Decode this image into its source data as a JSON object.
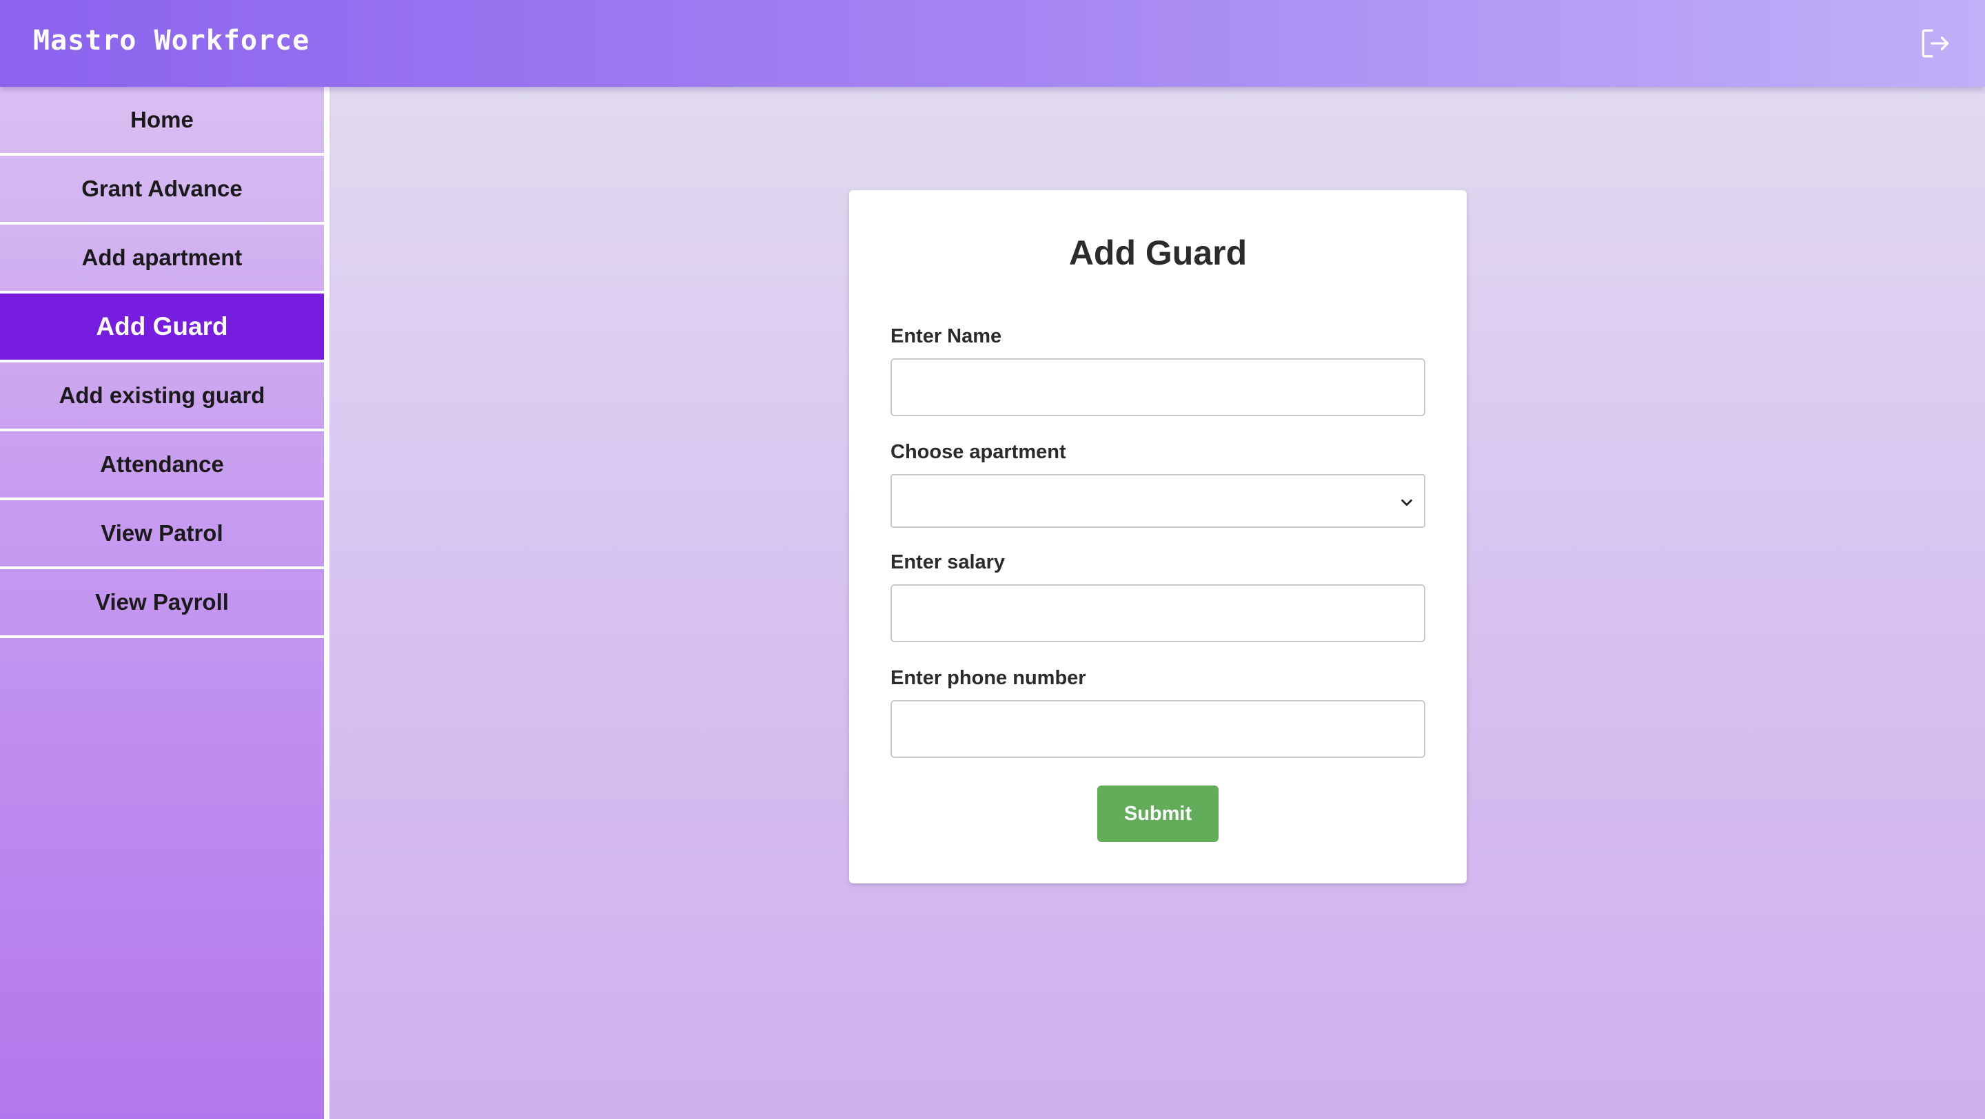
{
  "header": {
    "app_title": "Mastro Workforce",
    "logout_icon": "logout-icon"
  },
  "sidebar": {
    "items": [
      {
        "label": "Home",
        "active": false
      },
      {
        "label": "Grant Advance",
        "active": false
      },
      {
        "label": "Add apartment",
        "active": false
      },
      {
        "label": "Add Guard",
        "active": true
      },
      {
        "label": "Add existing guard",
        "active": false
      },
      {
        "label": "Attendance",
        "active": false
      },
      {
        "label": "View Patrol",
        "active": false
      },
      {
        "label": "View Payroll",
        "active": false
      }
    ]
  },
  "form": {
    "title": "Add Guard",
    "name_label": "Enter Name",
    "name_value": "",
    "apartment_label": "Choose apartment",
    "apartment_selected": "",
    "salary_label": "Enter salary",
    "salary_value": "",
    "phone_label": "Enter phone number",
    "phone_value": "",
    "submit_label": "Submit"
  },
  "colors": {
    "active_nav": "#761de0",
    "submit_button": "#63ad5a",
    "header_start": "#8b63ef",
    "header_end": "#bfb0f8"
  }
}
